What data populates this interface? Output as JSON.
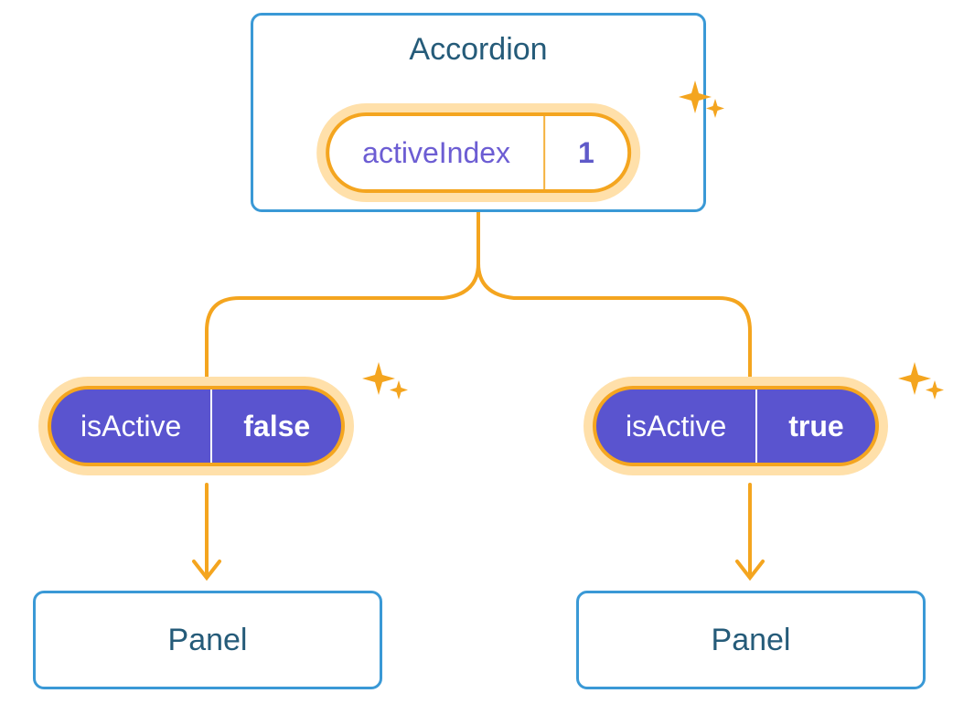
{
  "accordion": {
    "title": "Accordion",
    "state": {
      "key": "activeIndex",
      "value": "1"
    }
  },
  "children": [
    {
      "prop": {
        "key": "isActive",
        "value": "false"
      },
      "label": "Panel"
    },
    {
      "prop": {
        "key": "isActive",
        "value": "true"
      },
      "label": "Panel"
    }
  ],
  "colors": {
    "orange": "#f4a51f",
    "orangeHalo": "#ffe0aa",
    "blueBorder": "#3a99d6",
    "titleText": "#255b79",
    "purple": "#5a54cf"
  }
}
